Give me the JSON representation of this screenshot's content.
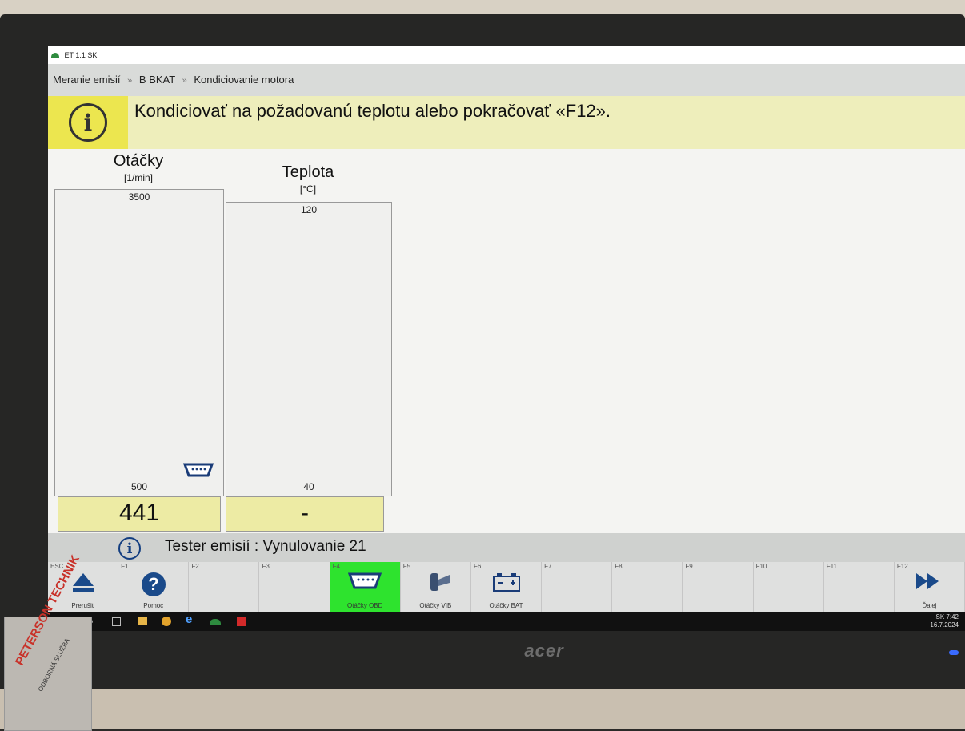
{
  "window": {
    "title": "ET 1.1 SK"
  },
  "breadcrumb": [
    "Meranie emisií",
    "B BKAT",
    "Kondiciovanie motora"
  ],
  "breadcrumb_sep": "»",
  "info": {
    "icon": "info-icon",
    "message": "Kondiciovať na požadovanú teplotu alebo pokračovať «F12»."
  },
  "gauges": [
    {
      "title": "Otáčky",
      "unit": "[1/min]",
      "max": "3500",
      "min": "500",
      "value": "441",
      "level": 0
    },
    {
      "title": "Teplota",
      "unit": "[°C]",
      "max": "120",
      "min": "40",
      "value": "-",
      "level": 0
    }
  ],
  "status": {
    "icon": "info-icon",
    "text": "Tester emisií : Vynulovanie 21"
  },
  "fkeys": [
    {
      "key": "ESC",
      "label": "Prerušiť",
      "icon": "eject-icon"
    },
    {
      "key": "F1",
      "label": "Pomoc",
      "icon": "help-icon"
    },
    {
      "key": "F2",
      "label": "",
      "icon": ""
    },
    {
      "key": "F3",
      "label": "",
      "icon": ""
    },
    {
      "key": "F4",
      "label": "Otáčky OBD",
      "icon": "obd-connector-icon",
      "active": true
    },
    {
      "key": "F5",
      "label": "Otáčky VIB",
      "icon": "vibration-sensor-icon"
    },
    {
      "key": "F6",
      "label": "Otáčky BAT",
      "icon": "battery-icon"
    },
    {
      "key": "F7",
      "label": "",
      "icon": ""
    },
    {
      "key": "F8",
      "label": "",
      "icon": ""
    },
    {
      "key": "F9",
      "label": "",
      "icon": ""
    },
    {
      "key": "F10",
      "label": "",
      "icon": ""
    },
    {
      "key": "F11",
      "label": "",
      "icon": ""
    },
    {
      "key": "F12",
      "label": "Ďalej",
      "icon": "fast-forward-icon"
    }
  ],
  "taskbar": {
    "tray_lang": "SK",
    "tray_time": "7:42",
    "tray_date": "16.7.2024"
  },
  "monitor": {
    "brand": "acer"
  },
  "box": {
    "brand": "PETERSON TECHNIK",
    "sub": "ODBORNÁ SLUŽBA"
  },
  "colors": {
    "accent": "#ece64f",
    "active_key": "#2ee32e",
    "readout": "#edeba4"
  }
}
